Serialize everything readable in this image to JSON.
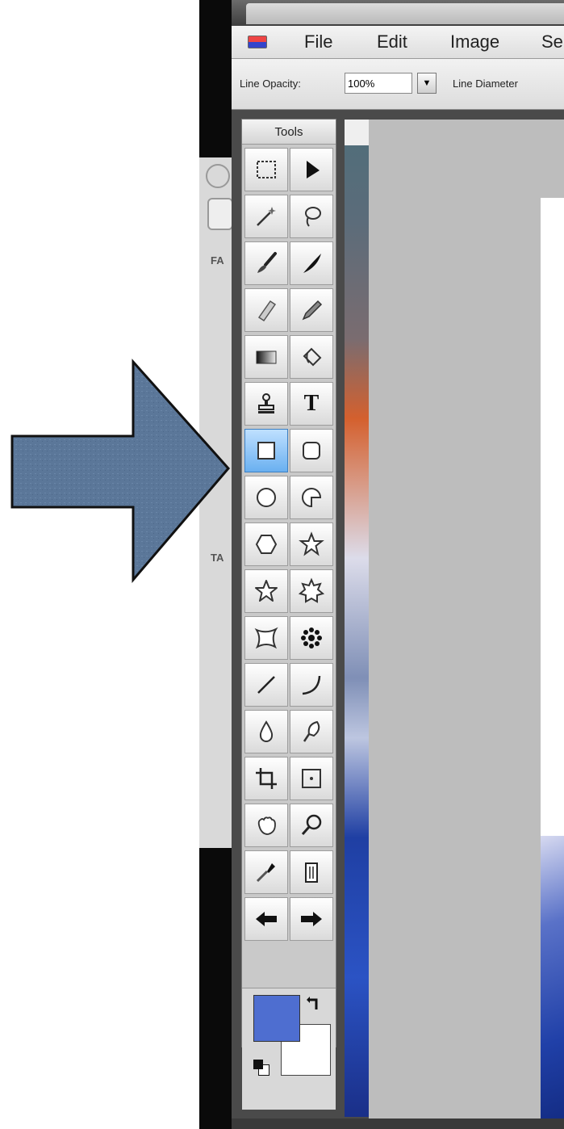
{
  "menu": {
    "items": [
      "File",
      "Edit",
      "Image",
      "Se"
    ]
  },
  "options": {
    "line_opacity_label": "Line Opacity:",
    "line_opacity_value": "100%",
    "line_diameter_label": "Line Diameter"
  },
  "tools_panel": {
    "title": "Tools",
    "selected_tool": "rectangle-tool",
    "tools": [
      [
        "marquee",
        "pointer"
      ],
      [
        "magic-wand",
        "lasso"
      ],
      [
        "brush",
        "smudge"
      ],
      [
        "eraser",
        "pencil"
      ],
      [
        "gradient",
        "fill"
      ],
      [
        "stamp",
        "text"
      ],
      [
        "rectangle",
        "rounded-rectangle"
      ],
      [
        "ellipse",
        "pie"
      ],
      [
        "polygon",
        "star"
      ],
      [
        "star-outline",
        "gear-star"
      ],
      [
        "custom-shape",
        "flower"
      ],
      [
        "line",
        "curve"
      ],
      [
        "drop",
        "burn"
      ],
      [
        "crop",
        "transform"
      ],
      [
        "hand",
        "zoom"
      ],
      [
        "eyedropper",
        "trash"
      ],
      [
        "back-arrow",
        "forward-arrow"
      ]
    ],
    "text_tool_glyph": "T"
  },
  "colors": {
    "foreground": "#4e6ed0",
    "background": "#ffffff",
    "arrow_fill": "#5b7799"
  },
  "background_panel": {
    "labels": [
      "FA",
      "TA"
    ]
  }
}
